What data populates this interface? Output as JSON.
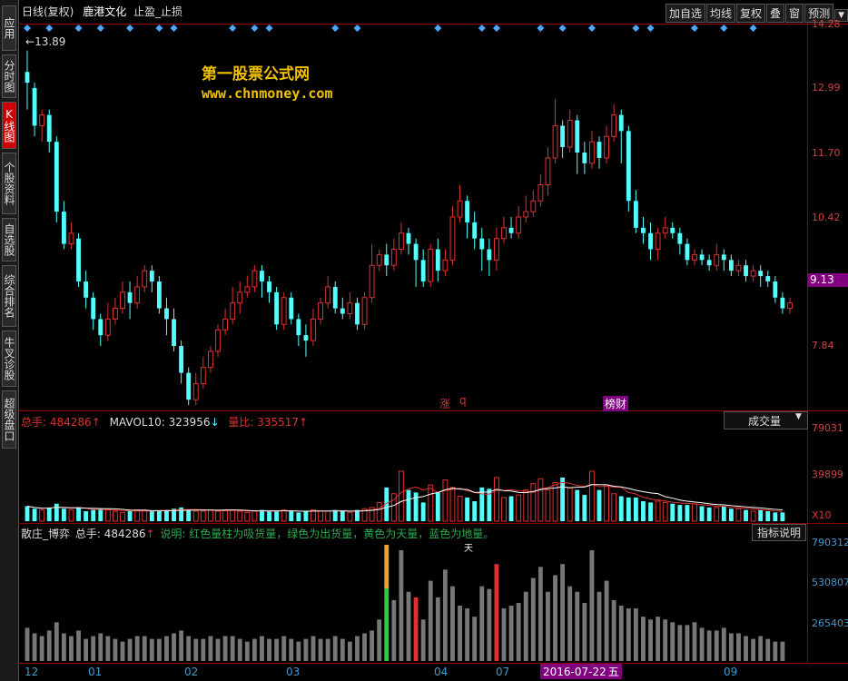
{
  "sidebar": {
    "tabs": [
      {
        "label": "应用",
        "active": false
      },
      {
        "label": "分时图",
        "active": false
      },
      {
        "label": "K线图",
        "active": true
      },
      {
        "label": "个股资料",
        "active": false
      },
      {
        "label": "自选股",
        "active": false
      },
      {
        "label": "综合排名",
        "active": false
      },
      {
        "label": "牛叉诊股",
        "active": false
      },
      {
        "label": "超级盘口",
        "active": false
      }
    ]
  },
  "header": {
    "chart_mode": "日线(复权)",
    "stock_name": "鹿港文化",
    "formula": "止盈_止损",
    "buttons": [
      "加自选",
      "均线",
      "复权",
      "叠",
      "窗",
      "预测"
    ],
    "menu_arrow": "▼"
  },
  "price_panel": {
    "axis_labels": [
      "14.28",
      "12.99",
      "11.70",
      "10.42",
      "9.13",
      "7.84"
    ],
    "current_price": "9.13",
    "high_marker": "13.89",
    "event_tags": [
      "涨",
      "q",
      "榜财"
    ],
    "watermark_title": "第一股票公式网",
    "watermark_url": "www.chnmoney.com"
  },
  "volume_panel": {
    "total_label": "总手:",
    "total_value": "484286",
    "mavol_label": "MAVOL10:",
    "mavol_value": "323956",
    "ratio_label": "量比:",
    "ratio_value": "335517",
    "selector": "成交量",
    "axis_labels": [
      "79031",
      "39899"
    ],
    "unit": "X10"
  },
  "indicator_panel": {
    "name": "散庄_博弈",
    "total_label": "总手:",
    "total_value": "484286",
    "description": "说明: 红色量柱为吸货量，绿色为出货量，黄色为天量，蓝色为地量。",
    "help_button": "指标说明",
    "axis_labels": [
      "790312",
      "530807",
      "265403"
    ],
    "marker_tian": "天"
  },
  "time_axis": {
    "labels": [
      "12",
      "01",
      "02",
      "03",
      "04",
      "07",
      "09"
    ],
    "cursor_date": "2016-07-22",
    "cursor_weekday": "五"
  },
  "colors": {
    "up": "#e03030",
    "down": "#54ffff",
    "grid": "#8b0000",
    "accent": "#800080"
  },
  "chart_data": {
    "type": "candlestick",
    "candles": [
      [
        13.5,
        13.3,
        13.9,
        12.8
      ],
      [
        13.2,
        12.5,
        13.3,
        12.3
      ],
      [
        12.5,
        12.7,
        12.8,
        12.2
      ],
      [
        12.7,
        12.2,
        12.8,
        12.0
      ],
      [
        12.2,
        10.9,
        12.3,
        10.7
      ],
      [
        10.9,
        10.3,
        11.1,
        10.2
      ],
      [
        10.3,
        10.5,
        10.7,
        10.2
      ],
      [
        10.4,
        9.6,
        10.5,
        9.5
      ],
      [
        9.6,
        9.3,
        9.8,
        9.1
      ],
      [
        9.3,
        8.9,
        9.4,
        8.7
      ],
      [
        8.9,
        8.6,
        9.0,
        8.4
      ],
      [
        8.6,
        8.9,
        9.2,
        8.5
      ],
      [
        8.9,
        9.1,
        9.3,
        8.8
      ],
      [
        9.1,
        9.4,
        9.6,
        9.0
      ],
      [
        9.4,
        9.2,
        9.6,
        8.9
      ],
      [
        9.2,
        9.5,
        9.7,
        9.1
      ],
      [
        9.5,
        9.8,
        9.9,
        9.4
      ],
      [
        9.8,
        9.6,
        9.9,
        9.4
      ],
      [
        9.6,
        9.1,
        9.7,
        9.0
      ],
      [
        9.1,
        8.9,
        9.3,
        8.6
      ],
      [
        8.9,
        8.4,
        9.1,
        8.3
      ],
      [
        8.4,
        7.9,
        8.5,
        7.7
      ],
      [
        7.9,
        7.4,
        8.0,
        7.3
      ],
      [
        7.4,
        7.7,
        7.9,
        7.3
      ],
      [
        7.7,
        8.0,
        8.2,
        7.6
      ],
      [
        8.0,
        8.3,
        8.4,
        7.9
      ],
      [
        8.3,
        8.7,
        8.8,
        8.2
      ],
      [
        8.7,
        8.9,
        9.1,
        8.6
      ],
      [
        8.9,
        9.2,
        9.5,
        8.8
      ],
      [
        9.2,
        9.4,
        9.6,
        9.0
      ],
      [
        9.4,
        9.5,
        9.7,
        9.3
      ],
      [
        9.5,
        9.8,
        9.9,
        9.4
      ],
      [
        9.8,
        9.6,
        9.9,
        9.3
      ],
      [
        9.6,
        9.4,
        9.7,
        9.2
      ],
      [
        9.4,
        8.8,
        9.5,
        8.7
      ],
      [
        8.8,
        9.3,
        9.4,
        8.7
      ],
      [
        9.3,
        8.9,
        9.4,
        8.8
      ],
      [
        8.9,
        8.6,
        9.0,
        8.4
      ],
      [
        8.6,
        8.5,
        8.8,
        8.2
      ],
      [
        8.5,
        8.9,
        9.1,
        8.4
      ],
      [
        8.9,
        9.2,
        9.3,
        8.8
      ],
      [
        9.2,
        9.5,
        9.7,
        9.1
      ],
      [
        9.5,
        9.1,
        9.6,
        9.0
      ],
      [
        9.1,
        9.0,
        9.3,
        8.9
      ],
      [
        9.0,
        9.2,
        9.4,
        8.9
      ],
      [
        9.2,
        8.8,
        9.3,
        8.7
      ],
      [
        8.8,
        9.3,
        9.4,
        8.7
      ],
      [
        9.3,
        9.9,
        10.3,
        9.2
      ],
      [
        9.9,
        10.1,
        10.2,
        9.8
      ],
      [
        10.1,
        9.9,
        10.3,
        9.7
      ],
      [
        9.9,
        10.2,
        10.4,
        9.8
      ],
      [
        10.2,
        10.5,
        10.7,
        10.1
      ],
      [
        10.5,
        10.3,
        10.6,
        10.1
      ],
      [
        10.3,
        10.0,
        10.4,
        9.5
      ],
      [
        10.0,
        9.6,
        10.2,
        9.5
      ],
      [
        9.6,
        10.2,
        10.3,
        9.5
      ],
      [
        10.2,
        9.8,
        10.4,
        9.6
      ],
      [
        9.8,
        10.0,
        10.2,
        9.7
      ],
      [
        10.0,
        10.8,
        11.0,
        9.9
      ],
      [
        10.8,
        11.1,
        11.4,
        10.7
      ],
      [
        11.1,
        10.7,
        11.2,
        10.4
      ],
      [
        10.7,
        10.4,
        10.9,
        10.2
      ],
      [
        10.4,
        10.2,
        10.6,
        9.8
      ],
      [
        10.2,
        10.0,
        10.4,
        9.7
      ],
      [
        10.0,
        10.4,
        10.6,
        9.8
      ],
      [
        10.4,
        10.6,
        10.8,
        10.3
      ],
      [
        10.6,
        10.5,
        10.8,
        10.4
      ],
      [
        10.5,
        10.8,
        11.0,
        10.4
      ],
      [
        10.8,
        10.9,
        11.2,
        10.7
      ],
      [
        10.9,
        11.1,
        11.3,
        10.8
      ],
      [
        11.1,
        11.4,
        11.6,
        11.0
      ],
      [
        11.4,
        11.9,
        12.1,
        11.2
      ],
      [
        11.9,
        12.5,
        13.0,
        11.8
      ],
      [
        12.5,
        12.1,
        12.6,
        11.9
      ],
      [
        12.1,
        12.6,
        12.8,
        12.0
      ],
      [
        12.6,
        12.0,
        12.7,
        11.6
      ],
      [
        12.0,
        11.8,
        12.2,
        11.6
      ],
      [
        11.8,
        12.2,
        12.4,
        11.7
      ],
      [
        12.2,
        11.9,
        12.3,
        11.7
      ],
      [
        11.9,
        12.3,
        12.5,
        11.8
      ],
      [
        12.3,
        12.7,
        12.9,
        12.2
      ],
      [
        12.7,
        12.4,
        12.8,
        11.8
      ],
      [
        12.4,
        11.1,
        12.5,
        10.9
      ],
      [
        11.1,
        10.6,
        11.3,
        10.5
      ],
      [
        10.6,
        10.5,
        10.8,
        10.3
      ],
      [
        10.5,
        10.2,
        10.7,
        10.0
      ],
      [
        10.2,
        10.5,
        10.6,
        10.0
      ],
      [
        10.5,
        10.6,
        10.8,
        10.4
      ],
      [
        10.6,
        10.5,
        10.7,
        10.4
      ],
      [
        10.5,
        10.3,
        10.6,
        10.1
      ],
      [
        10.3,
        10.0,
        10.4,
        9.9
      ],
      [
        10.0,
        10.1,
        10.2,
        9.9
      ],
      [
        10.1,
        10.0,
        10.2,
        9.9
      ],
      [
        10.0,
        9.9,
        10.1,
        9.8
      ],
      [
        9.9,
        10.1,
        10.3,
        9.8
      ],
      [
        10.1,
        10.0,
        10.2,
        9.8
      ],
      [
        10.0,
        9.8,
        10.1,
        9.7
      ],
      [
        9.8,
        9.9,
        10.0,
        9.7
      ],
      [
        9.9,
        9.7,
        10.0,
        9.6
      ],
      [
        9.7,
        9.8,
        9.9,
        9.6
      ],
      [
        9.8,
        9.7,
        9.9,
        9.5
      ],
      [
        9.7,
        9.6,
        9.8,
        9.5
      ],
      [
        9.6,
        9.3,
        9.7,
        9.2
      ],
      [
        9.3,
        9.1,
        9.4,
        9.0
      ],
      [
        9.1,
        9.2,
        9.3,
        9.0
      ]
    ],
    "price_ylim": [
      7.2,
      14.4
    ],
    "volume": [
      12,
      10,
      9,
      11,
      14,
      10,
      9,
      11,
      8,
      9,
      10,
      9,
      8,
      7,
      8,
      9,
      9,
      8,
      8,
      9,
      10,
      11,
      9,
      8,
      8,
      9,
      8,
      9,
      9,
      8,
      7,
      8,
      9,
      8,
      8,
      9,
      8,
      7,
      8,
      9,
      8,
      8,
      9,
      8,
      7,
      9,
      10,
      11,
      15,
      27,
      22,
      40,
      25,
      23,
      15,
      29,
      23,
      33,
      27,
      20,
      19,
      16,
      27,
      26,
      35,
      19,
      20,
      21,
      25,
      30,
      34,
      25,
      31,
      35,
      27,
      25,
      21,
      40,
      25,
      29,
      22,
      20,
      19,
      19,
      16,
      15,
      16,
      15,
      14,
      13,
      13,
      14,
      12,
      11,
      11,
      12,
      10,
      10,
      9,
      8,
      9,
      8,
      7,
      7
    ],
    "volume_ylim": [
      0,
      80000
    ]
  }
}
